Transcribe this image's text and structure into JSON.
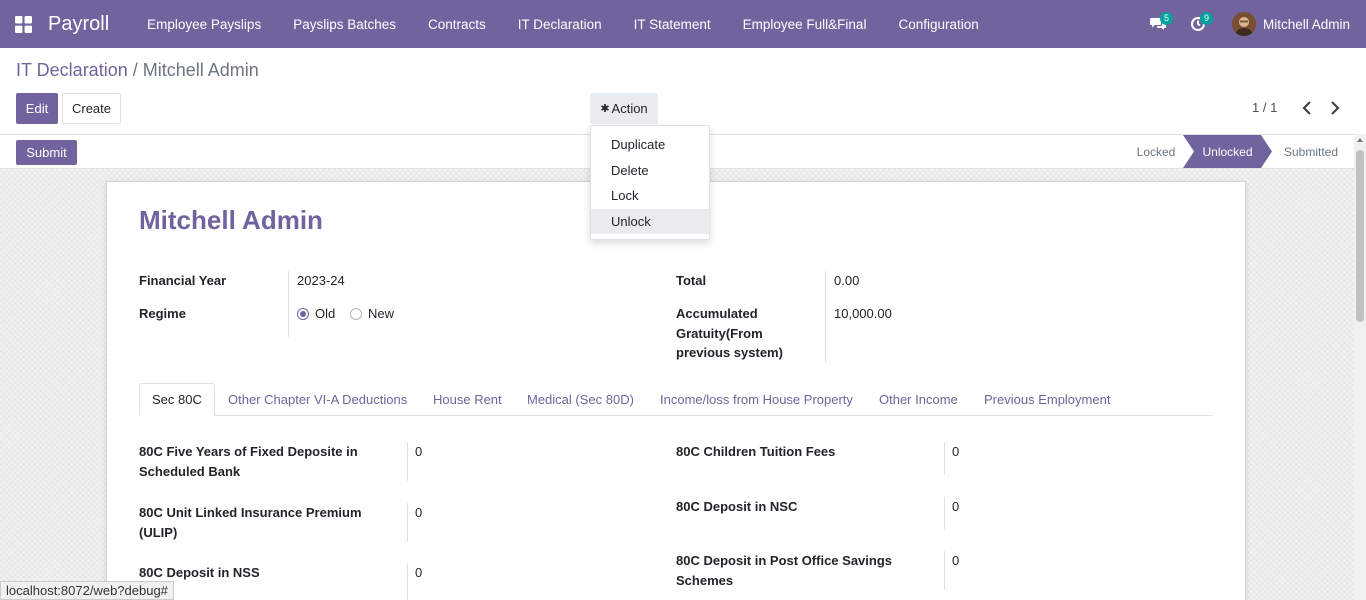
{
  "navbar": {
    "brand": "Payroll",
    "menu": [
      "Employee Payslips",
      "Payslips Batches",
      "Contracts",
      "IT Declaration",
      "IT Statement",
      "Employee Full&Final",
      "Configuration"
    ],
    "messages_count": "5",
    "activities_count": "9",
    "user_name": "Mitchell Admin"
  },
  "breadcrumb": {
    "parent": "IT Declaration",
    "separator": "/",
    "current": "Mitchell Admin"
  },
  "toolbar": {
    "edit_label": "Edit",
    "create_label": "Create",
    "action_label": "Action",
    "pager": "1 / 1"
  },
  "action_menu": [
    "Duplicate",
    "Delete",
    "Lock",
    "Unlock"
  ],
  "statusbar": {
    "submit_label": "Submit",
    "stages": [
      "Locked",
      "Unlocked",
      "Submitted"
    ],
    "active_stage": "Unlocked"
  },
  "form": {
    "title": "Mitchell Admin",
    "financial_year_label": "Financial Year",
    "financial_year": "2023-24",
    "regime_label": "Regime",
    "regime_old": "Old",
    "regime_new": "New",
    "total_label": "Total",
    "total": "0.00",
    "gratuity_label_1": "Accumulated",
    "gratuity_label_2": "Gratuity(From",
    "gratuity_label_3": "previous system)",
    "gratuity": "10,000.00"
  },
  "tabs": [
    "Sec 80C",
    "Other Chapter VI-A Deductions",
    "House Rent",
    "Medical (Sec 80D)",
    "Income/loss from House Property",
    "Other Income",
    "Previous Employment"
  ],
  "sec80c": {
    "left": [
      {
        "label1": "80C Five Years of Fixed Deposite in",
        "label2": "Scheduled Bank",
        "value": "0"
      },
      {
        "label1": "80C Unit Linked Insurance Premium",
        "label2": "(ULIP)",
        "value": "0"
      },
      {
        "label1": "80C Deposit in NSS",
        "label2": "",
        "value": "0"
      }
    ],
    "right": [
      {
        "label1": "80C Children Tuition Fees",
        "label2": "",
        "value": "0"
      },
      {
        "label1": "80C Deposit in NSC",
        "label2": "",
        "value": "0"
      },
      {
        "label1": "80C Deposit in Post Office Savings",
        "label2": "Schemes",
        "value": "0"
      }
    ]
  },
  "status_url": "localhost:8072/web?debug#",
  "colors": {
    "primary": "#71639e",
    "badge": "#00a09d"
  }
}
